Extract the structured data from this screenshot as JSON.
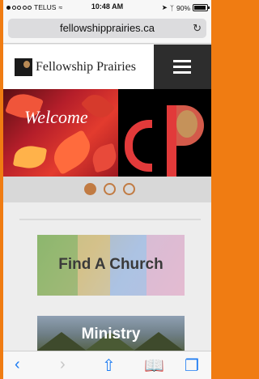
{
  "status_bar": {
    "carrier": "TELUS",
    "time": "10:48 AM",
    "battery": "90%"
  },
  "browser": {
    "url": "fellowshipprairies.ca"
  },
  "site": {
    "title": "Fellowship Prairies"
  },
  "hero": {
    "welcome": "Welcome"
  },
  "carousel": {
    "slide_count": 3,
    "active_index": 0
  },
  "cards": [
    {
      "label": "Find A Church"
    },
    {
      "label": "Ministry"
    }
  ],
  "colors": {
    "accent": "#f07c12",
    "header_dark": "#2d2d2d",
    "dot": "#c17b43",
    "ios_blue": "#1e7cf2"
  }
}
